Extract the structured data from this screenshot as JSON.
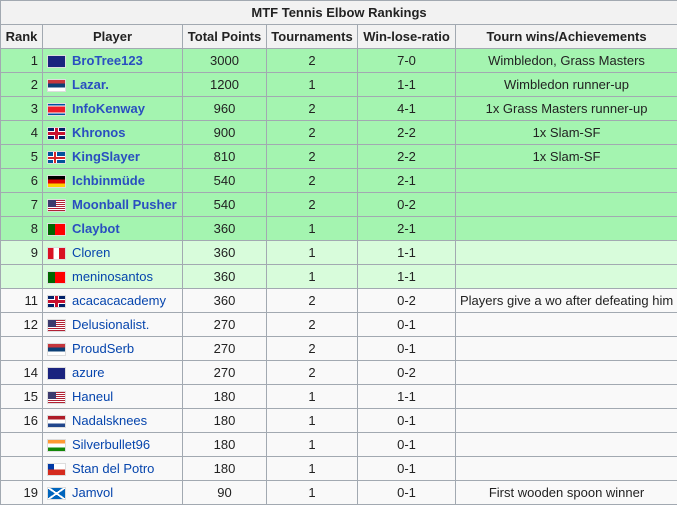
{
  "title": "MTF Tennis Elbow Rankings",
  "headers": [
    "Rank",
    "Player",
    "Total Points",
    "Tournaments",
    "Win-lose-ratio",
    "Tourn wins/Achievements"
  ],
  "rows": [
    {
      "rank": "1",
      "flag": "AU",
      "player": "BroTree123",
      "points": "3000",
      "tournaments": "2",
      "ratio": "7-0",
      "achievements": "Wimbledon, Grass Masters",
      "tier": "g1"
    },
    {
      "rank": "2",
      "flag": "RS",
      "player": "Lazar.",
      "points": "1200",
      "tournaments": "1",
      "ratio": "1-1",
      "achievements": "Wimbledon runner-up",
      "tier": "g1"
    },
    {
      "rank": "3",
      "flag": "KP",
      "player": "InfoKenway",
      "points": "960",
      "tournaments": "2",
      "ratio": "4-1",
      "achievements": "1x Grass Masters runner-up",
      "tier": "g1"
    },
    {
      "rank": "4",
      "flag": "GB",
      "player": "Khronos",
      "points": "900",
      "tournaments": "2",
      "ratio": "2-2",
      "achievements": "1x Slam-SF",
      "tier": "g1"
    },
    {
      "rank": "5",
      "flag": "IS",
      "player": "KingSlayer",
      "points": "810",
      "tournaments": "2",
      "ratio": "2-2",
      "achievements": "1x Slam-SF",
      "tier": "g1"
    },
    {
      "rank": "6",
      "flag": "DE",
      "player": "Ichbinmüde",
      "points": "540",
      "tournaments": "2",
      "ratio": "2-1",
      "achievements": "",
      "tier": "g1"
    },
    {
      "rank": "7",
      "flag": "US",
      "player": "Moonball Pusher",
      "points": "540",
      "tournaments": "2",
      "ratio": "0-2",
      "achievements": "",
      "tier": "g1"
    },
    {
      "rank": "8",
      "flag": "PT",
      "player": "Claybot",
      "points": "360",
      "tournaments": "1",
      "ratio": "2-1",
      "achievements": "",
      "tier": "g1"
    },
    {
      "rank": "9",
      "flag": "PE",
      "player": "Cloren",
      "points": "360",
      "tournaments": "1",
      "ratio": "1-1",
      "achievements": "",
      "tier": "g2"
    },
    {
      "rank": "",
      "flag": "PT",
      "player": "meninosantos",
      "points": "360",
      "tournaments": "1",
      "ratio": "1-1",
      "achievements": "",
      "tier": "g2"
    },
    {
      "rank": "11",
      "flag": "GB",
      "player": "acacacacademy",
      "points": "360",
      "tournaments": "2",
      "ratio": "0-2",
      "achievements": "Players give a wo after defeating him",
      "tier": "w"
    },
    {
      "rank": "12",
      "flag": "US",
      "player": "Delusionalist.",
      "points": "270",
      "tournaments": "2",
      "ratio": "0-1",
      "achievements": "",
      "tier": "w"
    },
    {
      "rank": "",
      "flag": "RS",
      "player": "ProudSerb",
      "points": "270",
      "tournaments": "2",
      "ratio": "0-1",
      "achievements": "",
      "tier": "w"
    },
    {
      "rank": "14",
      "flag": "AU",
      "player": "azure",
      "points": "270",
      "tournaments": "2",
      "ratio": "0-2",
      "achievements": "",
      "tier": "w"
    },
    {
      "rank": "15",
      "flag": "US",
      "player": "Haneul",
      "points": "180",
      "tournaments": "1",
      "ratio": "1-1",
      "achievements": "",
      "tier": "w"
    },
    {
      "rank": "16",
      "flag": "NL",
      "player": "Nadalsknees",
      "points": "180",
      "tournaments": "1",
      "ratio": "0-1",
      "achievements": "",
      "tier": "w"
    },
    {
      "rank": "",
      "flag": "IN",
      "player": "Silverbullet96",
      "points": "180",
      "tournaments": "1",
      "ratio": "0-1",
      "achievements": "",
      "tier": "w"
    },
    {
      "rank": "",
      "flag": "CL",
      "player": "Stan del Potro",
      "points": "180",
      "tournaments": "1",
      "ratio": "0-1",
      "achievements": "",
      "tier": "w"
    },
    {
      "rank": "19",
      "flag": "SCO",
      "player": "Jamvol",
      "points": "90",
      "tournaments": "1",
      "ratio": "0-1",
      "achievements": "First wooden spoon winner",
      "tier": "w"
    }
  ]
}
